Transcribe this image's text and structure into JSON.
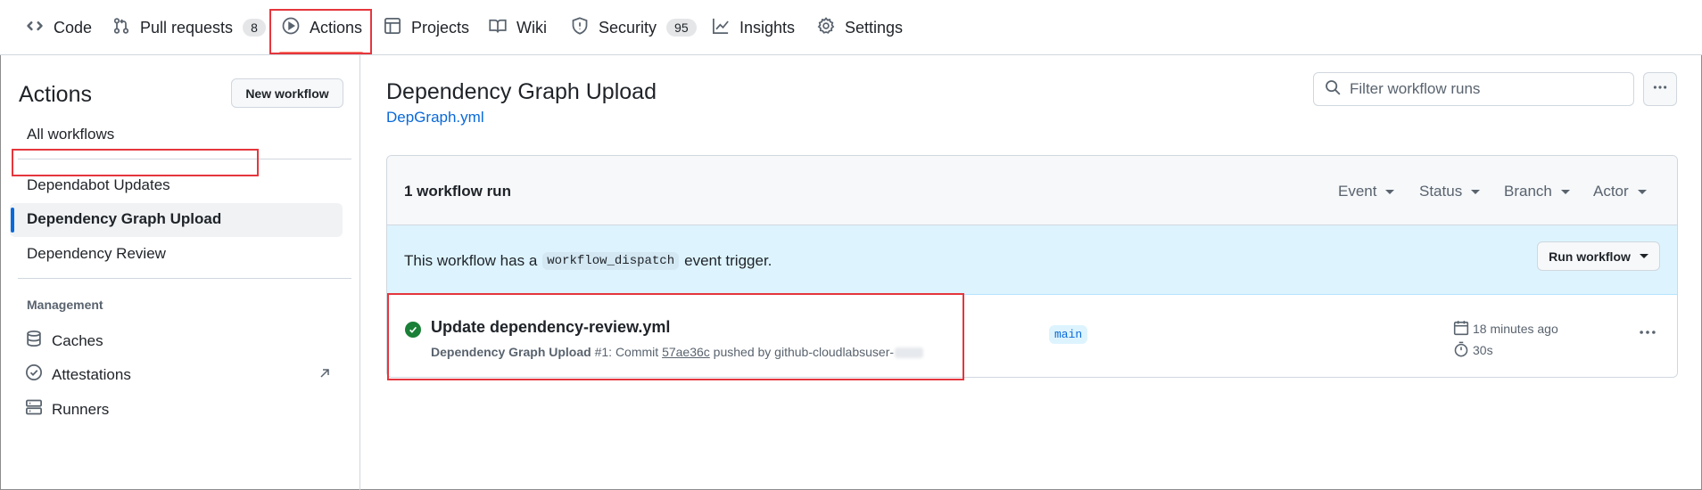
{
  "nav": {
    "tabs": [
      {
        "label": "Code",
        "icon": "code-icon"
      },
      {
        "label": "Pull requests",
        "icon": "git-pull-request-icon",
        "count": "8"
      },
      {
        "label": "Actions",
        "icon": "play-icon",
        "active": true
      },
      {
        "label": "Projects",
        "icon": "table-icon"
      },
      {
        "label": "Wiki",
        "icon": "book-icon"
      },
      {
        "label": "Security",
        "icon": "shield-icon",
        "count": "95"
      },
      {
        "label": "Insights",
        "icon": "graph-icon"
      },
      {
        "label": "Settings",
        "icon": "gear-icon"
      }
    ]
  },
  "sidebar": {
    "title": "Actions",
    "new_workflow": "New workflow",
    "all_workflows": "All workflows",
    "workflows": [
      "Dependabot Updates",
      "Dependency Graph Upload",
      "Dependency Review"
    ],
    "management_heading": "Management",
    "management": [
      {
        "label": "Caches",
        "icon": "database-icon"
      },
      {
        "label": "Attestations",
        "icon": "verified-icon"
      },
      {
        "label": "Runners",
        "icon": "server-icon"
      }
    ]
  },
  "main": {
    "title": "Dependency Graph Upload",
    "file": "DepGraph.yml",
    "filter_placeholder": "Filter workflow runs",
    "run_count": "1 workflow run",
    "filters": [
      "Event",
      "Status",
      "Branch",
      "Actor"
    ],
    "banner": {
      "prefix": "This workflow has a",
      "code": "workflow_dispatch",
      "suffix": "event trigger.",
      "button": "Run workflow"
    },
    "run": {
      "title": "Update dependency-review.yml",
      "workflow": "Dependency Graph Upload",
      "number": "#1",
      "commit_prefix": ": Commit",
      "sha": "57ae36c",
      "pushed_by": "pushed by github-cloudlabsuser-",
      "branch": "main",
      "time_ago": "18 minutes ago",
      "duration": "30s",
      "status": "success"
    }
  },
  "colors": {
    "accent": "#0969da",
    "success": "#1a7f37",
    "highlight": "#e5363d",
    "tab_underline": "#fd8c73",
    "banner_bg": "#ddf4ff"
  }
}
